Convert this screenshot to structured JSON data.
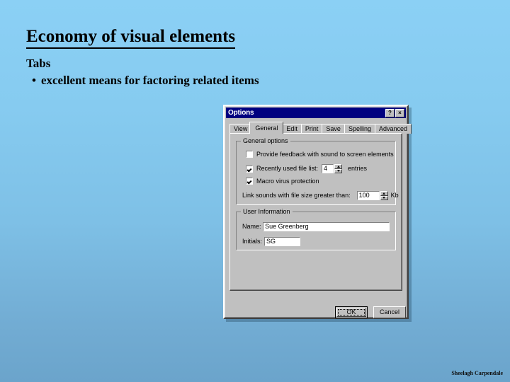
{
  "slide": {
    "title": "Economy of visual elements",
    "subhead": "Tabs",
    "bullet": "excellent means for factoring related items",
    "bullet_glyph": "•",
    "credit": "Sheelagh Carpendale",
    "background_top": "#8bd0f5",
    "background_bottom": "#6ba4cb"
  },
  "dialog": {
    "title": "Options",
    "titlebar_color": "#000080",
    "face_color": "#c0c0c0",
    "help_button": "?",
    "close_button": "×",
    "tabs": [
      {
        "label": "View",
        "active": false
      },
      {
        "label": "General",
        "active": true
      },
      {
        "label": "Edit",
        "active": false
      },
      {
        "label": "Print",
        "active": false
      },
      {
        "label": "Save",
        "active": false
      },
      {
        "label": "Spelling",
        "active": false
      },
      {
        "label": "Advanced",
        "active": false
      }
    ],
    "general_options": {
      "group_title": "General options",
      "provide_feedback": {
        "label": "Provide feedback with sound to screen elements",
        "checked": false
      },
      "recently_used": {
        "label": "Recently used file list:",
        "checked": true,
        "value": "4",
        "suffix": "entries"
      },
      "macro_virus": {
        "label": "Macro virus protection",
        "checked": true
      },
      "link_sounds": {
        "label": "Link sounds with file size greater than:",
        "value": "100",
        "suffix": "Kb"
      }
    },
    "user_information": {
      "group_title": "User Information",
      "name_label": "Name:",
      "name_value": "Sue Greenberg",
      "initials_label": "Initials:",
      "initials_value": "SG"
    },
    "buttons": {
      "ok": "OK",
      "cancel": "Cancel"
    }
  }
}
